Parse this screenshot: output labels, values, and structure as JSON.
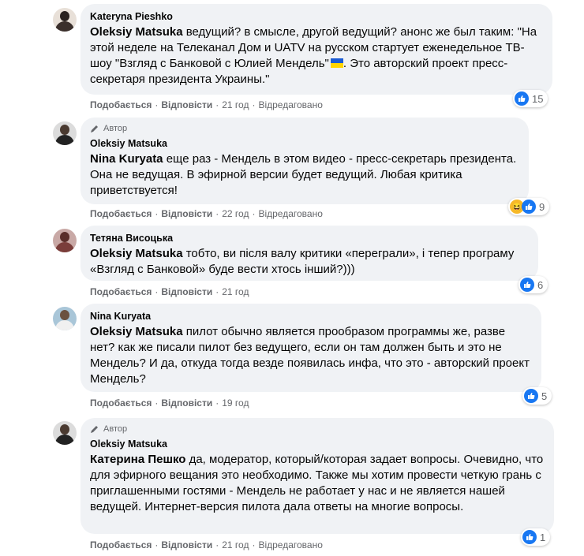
{
  "common": {
    "like_label": "Подобається",
    "reply_label": "Відповісти",
    "edited_label": "Відредаговано",
    "author_badge": "Автор",
    "dot": "·"
  },
  "comments": [
    {
      "author": "Kateryna Pieshko",
      "is_author": false,
      "mention": "Oleksiy Matsuka",
      "text": " ведущий? в смысле, другой ведущий? анонс же был таким: \"На этой неделе на Телеканал Дом и UATV на русском стартует еженедельное ТВ-шоу \"Взгляд с Банковой с Юлией Мендель\"",
      "text_after_flag": ". Это авторский проект пресс-секретаря президента Украины.\"",
      "time": "21 год",
      "edited": true,
      "reactions": [
        "like"
      ],
      "reaction_count": "15"
    },
    {
      "author": "Oleksiy Matsuka",
      "is_author": true,
      "mention": "Nina Kuryata",
      "text": " еще раз - Мендель в этом видео - пресс-секретарь президента. Она не ведущая. В эфирной версии будет ведущий. Любая критика приветствуется!",
      "time": "22 год",
      "edited": true,
      "reactions": [
        "haha",
        "like"
      ],
      "reaction_count": "9"
    },
    {
      "author": "Тетяна Висоцька",
      "is_author": false,
      "mention": "Oleksiy Matsuka",
      "text": " тобто, ви після валу критики «переграли», і тепер програму «Взгляд с Банковой» буде вести хтось інший?)))",
      "time": "21 год",
      "edited": false,
      "reactions": [
        "like"
      ],
      "reaction_count": "6"
    },
    {
      "author": "Nina Kuryata",
      "is_author": false,
      "mention": "Oleksiy Matsuka",
      "text": " пилот обычно является прообразом программы же, разве нет? как же писали пилот без ведущего, если он там должен быть и это не Мендель? И да, откуда тогда везде появилась инфа, что это - авторский проект Мендель?",
      "time": "19 год",
      "edited": false,
      "reactions": [
        "like"
      ],
      "reaction_count": "5"
    },
    {
      "author": "Oleksiy Matsuka",
      "is_author": true,
      "mention": "Катерина Пешко",
      "text": " да, модератор, который/которая задает вопросы. Очевидно, что для эфирного вещания это необходимо. Также мы хотим провести четкую грань с приглашенными гостями - Мендель не работает у нас и не является нашей ведущей. Интернет-версия пилота дала ответы на многие вопросы.",
      "time": "21 год",
      "edited": true,
      "reactions": [
        "like"
      ],
      "reaction_count": "1"
    }
  ]
}
